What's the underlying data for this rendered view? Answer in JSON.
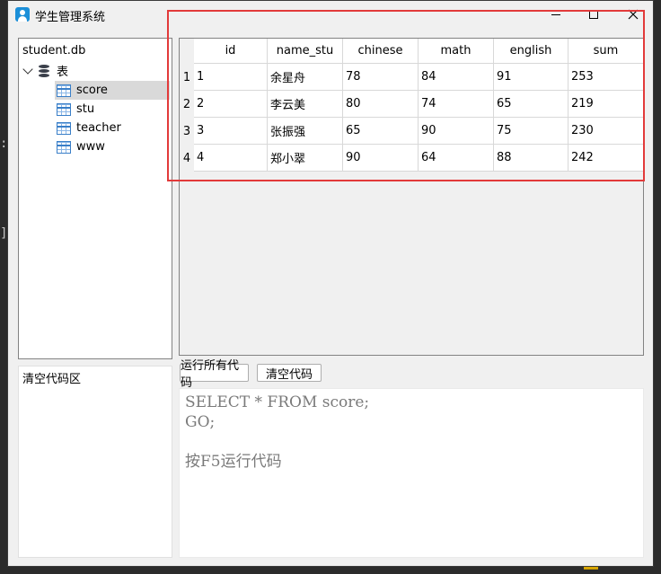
{
  "window": {
    "title": "学生管理系统"
  },
  "tree": {
    "root_label": "student.db",
    "group_label": "表",
    "tables": [
      "score",
      "stu",
      "teacher",
      "www"
    ],
    "selected": "score"
  },
  "grid": {
    "columns": [
      "id",
      "name_stu",
      "chinese",
      "math",
      "english",
      "sum"
    ],
    "rows": [
      {
        "num": "1",
        "cells": [
          "1",
          "余星舟",
          "78",
          "84",
          "91",
          "253"
        ]
      },
      {
        "num": "2",
        "cells": [
          "2",
          "李云美",
          "80",
          "74",
          "65",
          "219"
        ]
      },
      {
        "num": "3",
        "cells": [
          "3",
          "张振强",
          "65",
          "90",
          "75",
          "230"
        ]
      },
      {
        "num": "4",
        "cells": [
          "4",
          "郑小翠",
          "90",
          "64",
          "88",
          "242"
        ]
      }
    ]
  },
  "buttons": {
    "run_all": "运行所有代码",
    "clear_code": "清空代码"
  },
  "code_area_label": "清空代码区",
  "editor": {
    "line1": "SELECT * FROM score;",
    "line2": "GO;",
    "hint": "按F5运行代码"
  },
  "colors": {
    "highlight": "#e23a3a",
    "accent": "#1b8fd8"
  },
  "icons": {
    "app": "student-icon",
    "db": "database-icon",
    "table": "table-icon"
  }
}
